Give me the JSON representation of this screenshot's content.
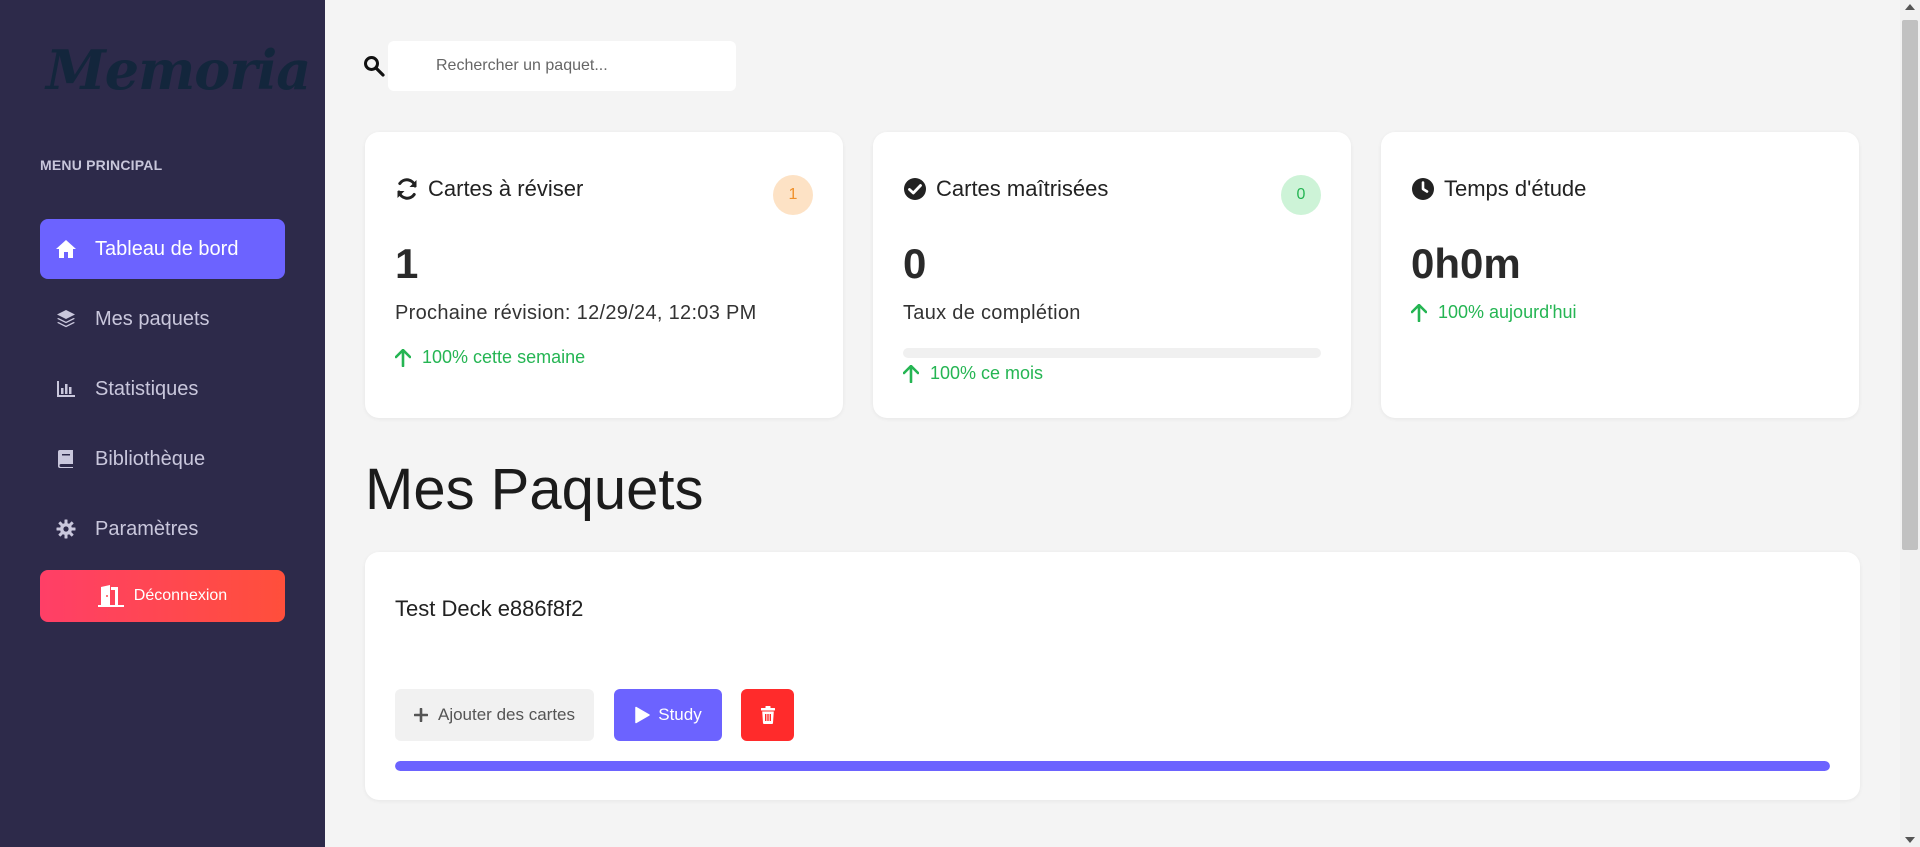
{
  "sidebar": {
    "logo": "Memoria",
    "menu_title": "MENU PRINCIPAL",
    "items": [
      {
        "label": "Tableau de bord",
        "icon": "home-icon",
        "active": true
      },
      {
        "label": "Mes paquets",
        "icon": "layers-icon",
        "active": false
      },
      {
        "label": "Statistiques",
        "icon": "bar-chart-icon",
        "active": false
      },
      {
        "label": "Bibliothèque",
        "icon": "book-icon",
        "active": false
      },
      {
        "label": "Paramètres",
        "icon": "gear-icon",
        "active": false
      }
    ],
    "logout_label": "Déconnexion"
  },
  "search": {
    "placeholder": "Rechercher un paquet..."
  },
  "stats": [
    {
      "title": "Cartes à réviser",
      "icon": "refresh-icon",
      "badge": "1",
      "badge_color": "#f0902a",
      "value": "1",
      "subtitle": "Prochaine révision: 12/29/24, 12:03 PM",
      "trend": "100% cette semaine"
    },
    {
      "title": "Cartes maîtrisées",
      "icon": "check-circle-icon",
      "badge": "0",
      "badge_color": "#25b553",
      "value": "0",
      "subtitle": "Taux de complétion",
      "completion": 0,
      "trend": "100% ce mois"
    },
    {
      "title": "Temps d'étude",
      "icon": "clock-icon",
      "value": "0h0m",
      "trend": "100% aujourd'hui"
    }
  ],
  "section_title": "Mes Paquets",
  "decks": [
    {
      "name": "Test Deck e886f8f2",
      "add_label": "Ajouter des cartes",
      "study_label": "Study",
      "progress": 1.0
    }
  ],
  "colors": {
    "accent": "#6c63ff",
    "sidebar_bg": "#2d2a4a",
    "success": "#25b553",
    "danger": "#ff2b2b"
  }
}
